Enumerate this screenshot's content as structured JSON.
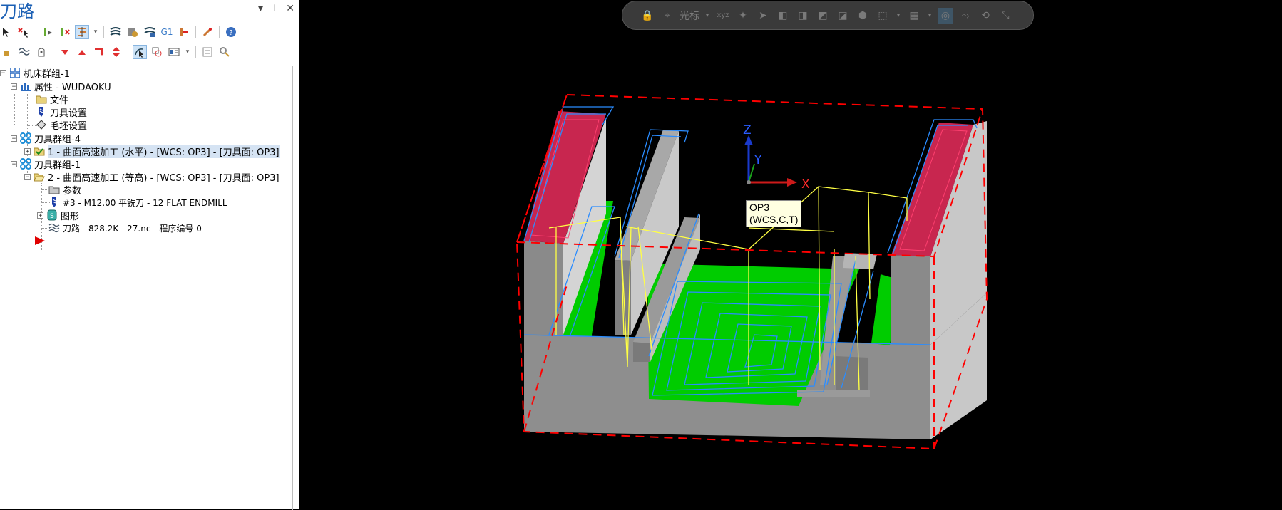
{
  "panel": {
    "title": "刀路",
    "controls": [
      "▼",
      "📌",
      "✕"
    ]
  },
  "tree": {
    "machine_group": "机床群组-1",
    "properties": "属性 - WUDAOKU",
    "files": "文件",
    "tool_settings": "刀具设置",
    "stock_settings": "毛坯设置",
    "toolpath_group_4": "刀具群组-4",
    "op1": "1 - 曲面高速加工 (水平) - [WCS: OP3] - [刀具面: OP3]",
    "toolpath_group_1": "刀具群组-1",
    "op2": "2 - 曲面高速加工 (等高) - [WCS: OP3] - [刀具面: OP3]",
    "params": "参数",
    "tool": "#3 - M12.00 平铣刀 - 12 FLAT ENDMILL",
    "geometry": "图形",
    "toolpath": "刀路 - 828.2K - 27.nc - 程序编号 0"
  },
  "toolbar1": {
    "g1_label": "G1"
  },
  "viewport_toolbar": {
    "cursor_label": "光标",
    "xyz_label": "xyz"
  },
  "axes": {
    "x": "X",
    "y": "Y",
    "z": "Z"
  },
  "tooltip": {
    "line1": "OP3",
    "line2": "(WCS,C,T)"
  },
  "colors": {
    "accent": "#1a5fb4",
    "floor_green": "#00cc00",
    "top_red": "#c8264f",
    "stock_box": "#ff0000",
    "path_blue": "#2a8cff",
    "path_yellow": "#ffff44"
  }
}
